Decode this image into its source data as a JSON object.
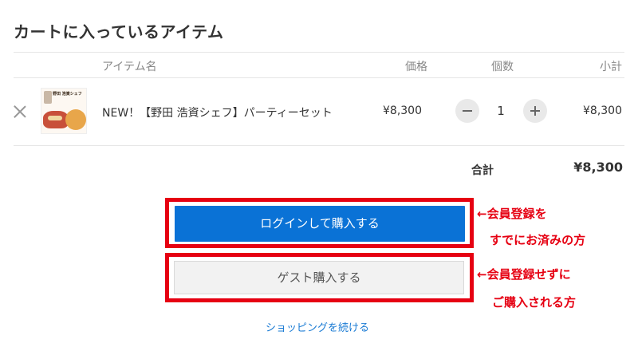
{
  "page_title": "カートに入っているアイテム",
  "table": {
    "headers": {
      "item": "アイテム名",
      "price": "価格",
      "quantity": "個数",
      "subtotal": "小計"
    }
  },
  "item": {
    "name": "NEW！【野田 浩資シェフ】パーティーセット",
    "thumbnail_text": "野田 浩資シェフ",
    "price": "¥8,300",
    "quantity": "1",
    "subtotal": "¥8,300"
  },
  "summary": {
    "total_label": "合計",
    "total_value": "¥8,300"
  },
  "buttons": {
    "login_purchase": "ログインして購入する",
    "guest_purchase": "ゲスト購入する",
    "continue_shopping": "ショッピングを続ける"
  },
  "annotations": {
    "login_line1": "←会員登録を",
    "login_line2": "すでにお済みの方",
    "guest_line1": "←会員登録せずに",
    "guest_line2": "ご購入される方"
  },
  "colors": {
    "primary_button": "#0a72d6",
    "annotation_red": "#e60012",
    "link": "#1a7bd4"
  }
}
